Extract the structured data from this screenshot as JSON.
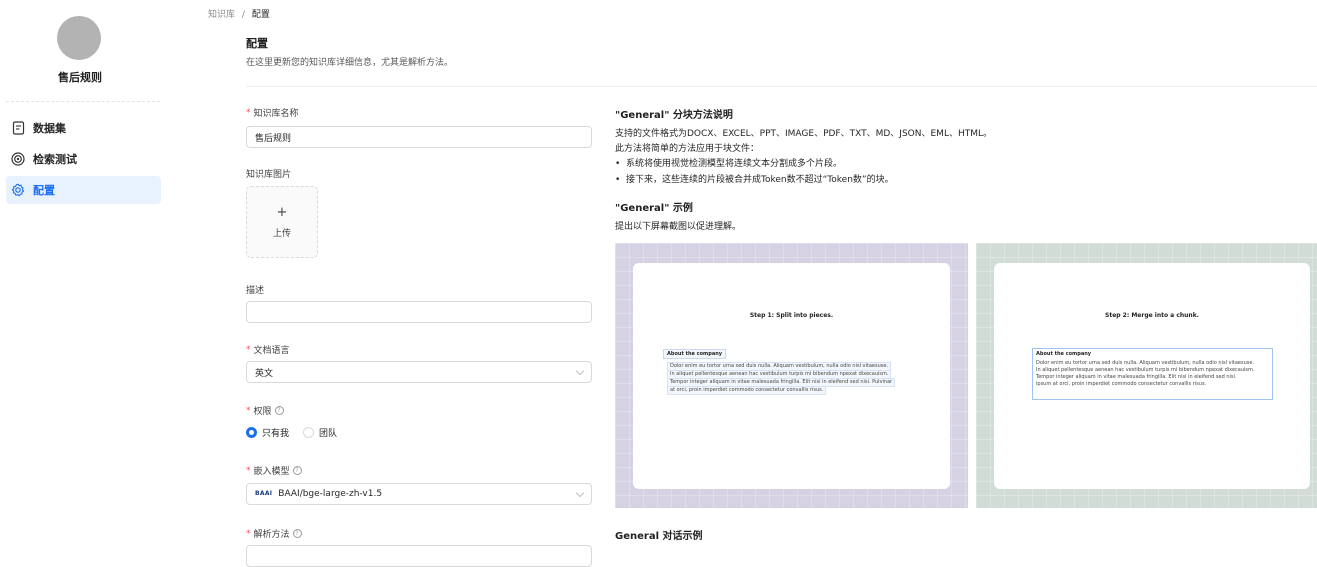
{
  "sidebar": {
    "kb_name": "售后规则",
    "items": [
      {
        "label": "数据集",
        "icon": "file-text-icon",
        "active": false
      },
      {
        "label": "检索测试",
        "icon": "target-icon",
        "active": false
      },
      {
        "label": "配置",
        "icon": "gear-icon",
        "active": true
      }
    ]
  },
  "breadcrumb": {
    "root": "知识库",
    "sep": "/",
    "current": "配置"
  },
  "header": {
    "title": "配置",
    "subtitle": "在这里更新您的知识库详细信息，尤其是解析方法。"
  },
  "form": {
    "name_label": "知识库名称",
    "name_value": "售后规则",
    "image_label": "知识库图片",
    "upload_plus": "+",
    "upload_label": "上传",
    "desc_label": "描述",
    "desc_value": "",
    "lang_label": "文档语言",
    "lang_value": "英文",
    "perm_label": "权限",
    "perm_options": [
      "只有我",
      "团队"
    ],
    "perm_selected": "只有我",
    "embed_label": "嵌入模型",
    "embed_logo": "BAAI",
    "embed_value": "BAAI/bge-large-zh-v1.5",
    "parse_label": "解析方法"
  },
  "help_icon": "?",
  "right": {
    "method_title": "\"General\" 分块方法说明",
    "formats": "支持的文件格式为DOCX、EXCEL、PPT、IMAGE、PDF、TXT、MD、JSON、EML、HTML。",
    "desc": "此方法将简单的方法应用于块文件：",
    "bullets": [
      "系统将使用视觉检测模型将连续文本分割成多个片段。",
      "接下来，这些连续的片段被合并成Token数不超过“Token数”的块。"
    ],
    "example_title": "\"General\" 示例",
    "example_sub": "提出以下屏幕截图以促进理解。",
    "chat_title": "General 对话示例",
    "panel_colors": [
      "#d6d2e3",
      "#d2dcd6"
    ],
    "step1": "Step 1: Split into pieces.",
    "step2": "Step 2: Merge into a chunk.",
    "chunk_head": "About the company",
    "chunk_lines": [
      "Dolor enim eu tortor urna sed duis nulla. Aliquam vestibulum, nulla odio nisl vitaesuse.",
      "In aliquet pellentesque aenean hac vestibulum turpis mi bibendum npexat dixecauism.",
      "Tempor integer aliquam in vitae malesuada fringilla. Elit nisi in eleifend sed nisi. Pulvinar",
      "at orci, proin imperdiet commodo consectetur convallis risus."
    ],
    "merge_lines": [
      "Dolor enim eu tortor urna sed duis nulla. Aliquam vestibulum, nulla odio nisl vitaesuse.",
      "In aliquet pellentesque aenean hac vestibulum turpis mi bibendum npexat dixecauism.",
      "Tempor integer aliquam in vitae malesuada fringilla. Elit nisi in eleifend sed nisi.",
      "ipsum at orci, proin imperdiet commodo consectetur convallis risus."
    ]
  }
}
